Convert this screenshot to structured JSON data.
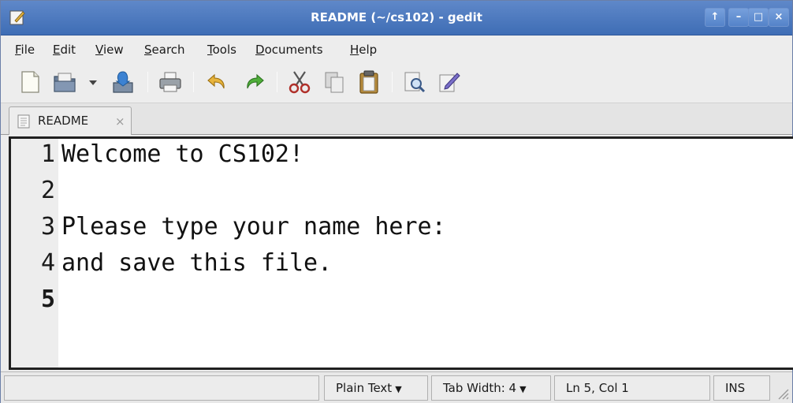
{
  "window": {
    "title": "README (~/cs102) - gedit"
  },
  "window_controls": [
    "↑",
    "–",
    "□",
    "×"
  ],
  "menu": [
    {
      "label": "File",
      "accel": "F",
      "rest": "ile"
    },
    {
      "label": "Edit",
      "accel": "E",
      "rest": "dit"
    },
    {
      "label": "View",
      "accel": "V",
      "rest": "iew"
    },
    {
      "label": "Search",
      "accel": "S",
      "rest": "earch"
    },
    {
      "label": "Tools",
      "accel": "T",
      "rest": "ools"
    },
    {
      "label": "Documents",
      "accel": "D",
      "rest": "ocuments"
    },
    {
      "label": "Help",
      "accel": "H",
      "rest": "elp"
    }
  ],
  "toolbar_icons": [
    "new-document-icon",
    "open-icon",
    "open-dropdown-icon",
    "save-icon",
    "print-icon",
    "undo-icon",
    "redo-icon",
    "cut-icon",
    "copy-icon",
    "paste-icon",
    "find-icon",
    "find-replace-icon"
  ],
  "tab": {
    "label": "README",
    "close": "×"
  },
  "editor": {
    "lines": [
      {
        "num": "1",
        "text": "Welcome to CS102!"
      },
      {
        "num": "2",
        "text": ""
      },
      {
        "num": "3",
        "text": "Please type your name here:"
      },
      {
        "num": "4",
        "text": "and save this file."
      },
      {
        "num": "5",
        "text": ""
      }
    ],
    "current_line": 5
  },
  "statusbar": {
    "language": "Plain Text",
    "tab_width": "Tab Width: 4",
    "position": "Ln 5, Col 1",
    "mode": "INS"
  },
  "colors": {
    "titlebar": "#4a78be",
    "editor_border": "#202020",
    "gutter": "#ededed"
  }
}
